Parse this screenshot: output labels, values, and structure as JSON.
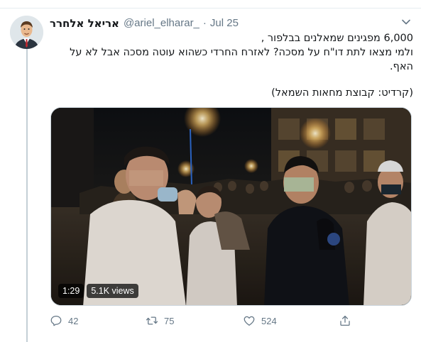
{
  "tweet": {
    "display_name": "אריאל אלחרר",
    "handle": "@ariel_elharar_",
    "separator": "·",
    "date": "Jul 25",
    "text_lines": [
      "6,000 מפגינים שמאלנים בבלפור ,",
      "ולמי מצאו לתת דו\"ח על מסכה? לאזרח החרדי כשהוא עוטה מסכה אבל לא על",
      "האף."
    ],
    "credit_line": "(קרדיט: קבוצת מחאות השמאל)"
  },
  "video": {
    "duration": "1:29",
    "views": "5.1K views"
  },
  "actions": {
    "replies": "42",
    "retweets": "75",
    "likes": "524"
  },
  "icons": [
    "caret-down-icon",
    "reply-icon",
    "retweet-icon",
    "like-icon",
    "share-icon"
  ],
  "colors": {
    "text_primary": "#14171a",
    "text_secondary": "#657786",
    "border": "#e6ecf0",
    "thread_line": "#c4cfd6"
  }
}
